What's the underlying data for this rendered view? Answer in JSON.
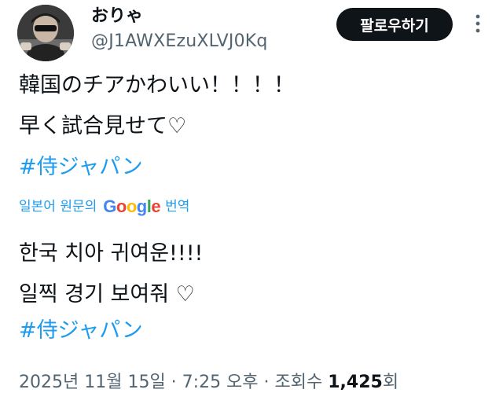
{
  "user": {
    "display_name": "おりゃ",
    "handle": "@J1AWXEzuXLVJ0Kq"
  },
  "follow_button": {
    "label": "팔로우하기"
  },
  "more_icon": "more-vertical-icon",
  "original": {
    "line1": "韓国のチアかわいい！！！！",
    "line2": "早く試合見せて♡",
    "hashtag": "#侍ジャパン"
  },
  "translation": {
    "prefix": "일본어 원문의",
    "google_letters": [
      "G",
      "o",
      "o",
      "g",
      "l",
      "e"
    ],
    "suffix": "번역",
    "line1": "한국 치아 귀여운!!!!",
    "line2": "일찍 경기 보여줘 ♡",
    "hashtag": "#侍ジャパン"
  },
  "meta": {
    "timestamp": "2025년 11월 15일 · 7:25 오후",
    "separator": " · ",
    "views_label": "조회수 ",
    "views_count": "1,425",
    "views_suffix": "회"
  },
  "colors": {
    "link": "#1d9bf0",
    "secondary_text": "#536471",
    "primary_text": "#0f1419",
    "button_bg": "#0f1419"
  }
}
